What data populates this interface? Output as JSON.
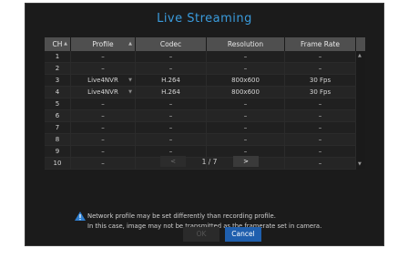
{
  "dialog": {
    "title": "Live Streaming"
  },
  "table": {
    "headers": [
      "CH",
      "Profile",
      "Codec",
      "Resolution",
      "Frame Rate"
    ],
    "rows": [
      {
        "ch": "1",
        "profile": "–",
        "codec": "–",
        "resolution": "–",
        "frame_rate": "–",
        "dropdown": false
      },
      {
        "ch": "2",
        "profile": "–",
        "codec": "–",
        "resolution": "–",
        "frame_rate": "–",
        "dropdown": false
      },
      {
        "ch": "3",
        "profile": "Live4NVR",
        "codec": "H.264",
        "resolution": "800x600",
        "frame_rate": "30 Fps",
        "dropdown": true
      },
      {
        "ch": "4",
        "profile": "Live4NVR",
        "codec": "H.264",
        "resolution": "800x600",
        "frame_rate": "30 Fps",
        "dropdown": true
      },
      {
        "ch": "5",
        "profile": "–",
        "codec": "–",
        "resolution": "–",
        "frame_rate": "–",
        "dropdown": false
      },
      {
        "ch": "6",
        "profile": "–",
        "codec": "–",
        "resolution": "–",
        "frame_rate": "–",
        "dropdown": false
      },
      {
        "ch": "7",
        "profile": "–",
        "codec": "–",
        "resolution": "–",
        "frame_rate": "–",
        "dropdown": false
      },
      {
        "ch": "8",
        "profile": "–",
        "codec": "–",
        "resolution": "–",
        "frame_rate": "–",
        "dropdown": false
      },
      {
        "ch": "9",
        "profile": "–",
        "codec": "–",
        "resolution": "–",
        "frame_rate": "–",
        "dropdown": false
      },
      {
        "ch": "10",
        "profile": "–",
        "codec": "–",
        "resolution": "–",
        "frame_rate": "–",
        "dropdown": false
      }
    ]
  },
  "pager": {
    "prev_label": "<",
    "info": "1 / 7",
    "next_label": ">"
  },
  "note": {
    "line1": "Network profile may be set differently than recording profile.",
    "line2": "In this case, image may not be transmitted as the framerate set in camera."
  },
  "buttons": {
    "ok_label": "OK",
    "cancel_label": "Cancel"
  },
  "colors": {
    "title": "#3a9bdc",
    "cancel": "#1f5fae",
    "warning": "#2f7fd0"
  }
}
